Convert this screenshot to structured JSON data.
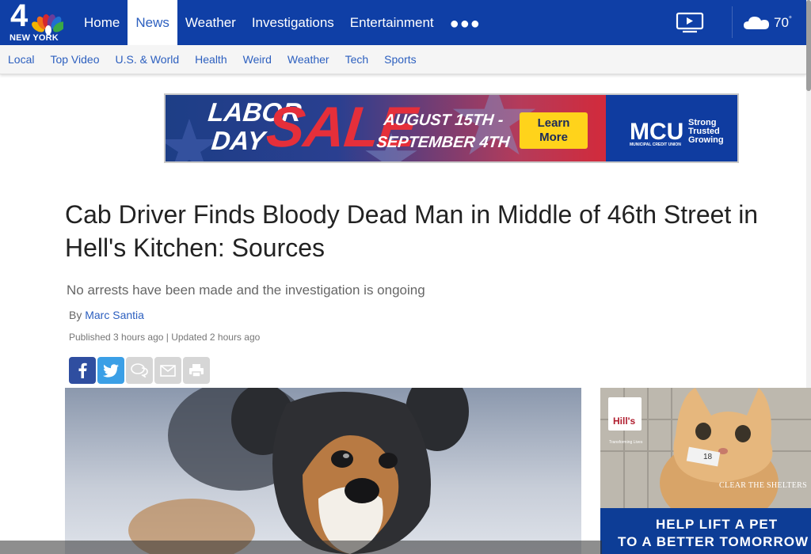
{
  "brand": {
    "logo_number": "4",
    "logo_city": "NEW YORK",
    "colors": {
      "primary": "#0f3fa6",
      "link": "#2c5fbf"
    }
  },
  "main_nav": {
    "items": [
      {
        "label": "Home",
        "active": false
      },
      {
        "label": "News",
        "active": true
      },
      {
        "label": "Weather",
        "active": false
      },
      {
        "label": "Investigations",
        "active": false
      },
      {
        "label": "Entertainment",
        "active": false
      }
    ],
    "more_icon": "ellipsis-icon",
    "video_icon": "tv-play-icon"
  },
  "weather_widget": {
    "icon": "cloud-icon",
    "temp": "70",
    "unit": "°"
  },
  "sub_nav": {
    "items": [
      "Local",
      "Top Video",
      "U.S. & World",
      "Health",
      "Weird",
      "Weather",
      "Tech",
      "Sports"
    ]
  },
  "ad_banner": {
    "line1": "LABOR",
    "line2": "DAY",
    "sale": "SALE",
    "dates_line1": "AUGUST 15TH -",
    "dates_line2": "SEPTEMBER 4TH",
    "cta_line1": "Learn",
    "cta_line2": "More",
    "brand": "MCU",
    "brand_sub": "MUNICIPAL CREDIT UNION",
    "tag1": "Strong",
    "tag2": "Trusted",
    "tag3": "Growing"
  },
  "article": {
    "headline": "Cab Driver Finds Bloody Dead Man in Middle of 46th Street in Hell's Kitchen: Sources",
    "dek": "No arrests have been made and the investigation is ongoing",
    "by_prefix": "By",
    "author": "Marc Santia",
    "dates": "Published 3 hours ago | Updated 2 hours ago",
    "share_buttons": [
      "facebook-icon",
      "twitter-icon",
      "comment-icon",
      "email-icon",
      "print-icon"
    ]
  },
  "side_ad": {
    "brand": "Hill's",
    "brand_sub": "Transforming Lives",
    "tag_number": "18",
    "partner": "CLEAR THE SHELTERS",
    "line1": "HELP LIFT A PET",
    "line2": "TO A BETTER TOMORROW"
  }
}
